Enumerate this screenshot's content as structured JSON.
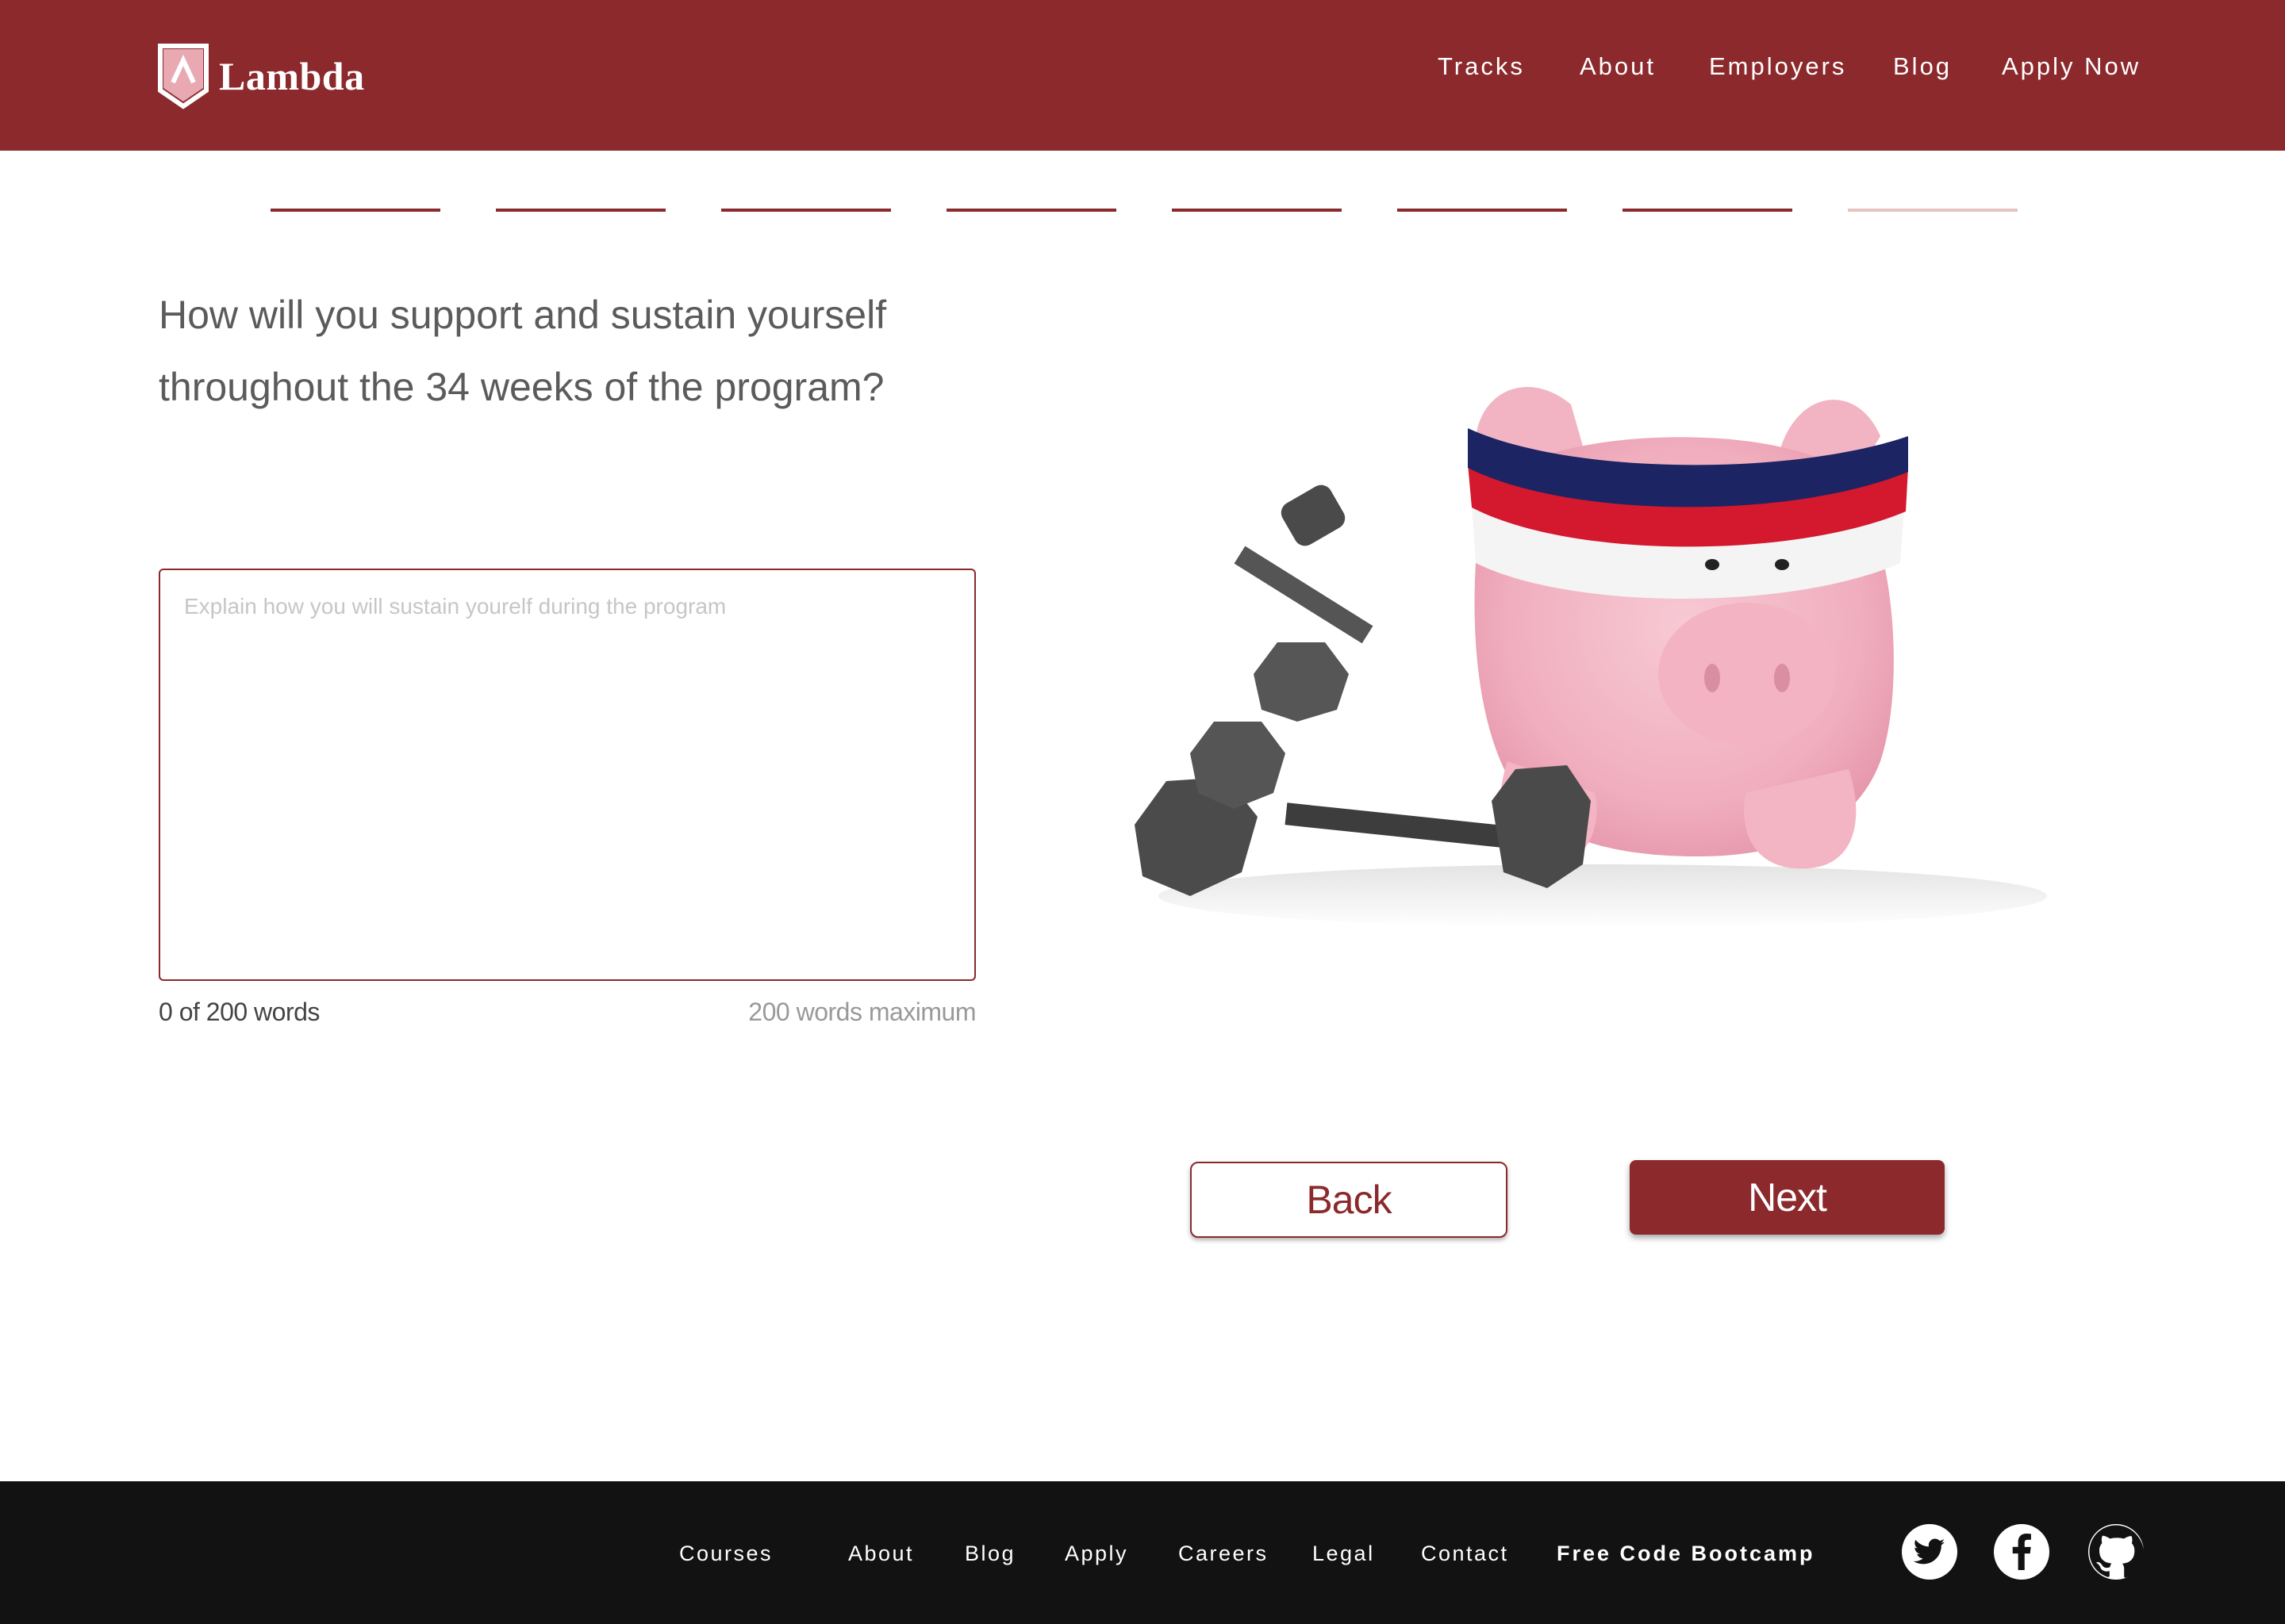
{
  "header": {
    "brand": "Lambda",
    "nav": [
      "Tracks",
      "About",
      "Employers",
      "Blog",
      "Apply Now"
    ]
  },
  "progress": {
    "total_steps": 8,
    "completed_steps": 7
  },
  "question": {
    "line1": "How will you support and sustain yourself",
    "line2": "throughout the 34 weeks of the program?"
  },
  "answer": {
    "value": "",
    "placeholder": "Explain how you will sustain yourelf during the program",
    "word_count": "0 of 200 words",
    "word_limit": "200 words maximum"
  },
  "buttons": {
    "back": "Back",
    "next": "Next"
  },
  "footer": {
    "links": [
      "Courses",
      "About",
      "Blog",
      "Apply",
      "Careers",
      "Legal",
      "Contact",
      "Free Code Bootcamp"
    ],
    "social": [
      "twitter-icon",
      "facebook-icon",
      "github-icon"
    ]
  },
  "colors": {
    "brand": "#8b292c",
    "footer_bg": "#121212",
    "progress_pending": "#e6c3c3"
  }
}
